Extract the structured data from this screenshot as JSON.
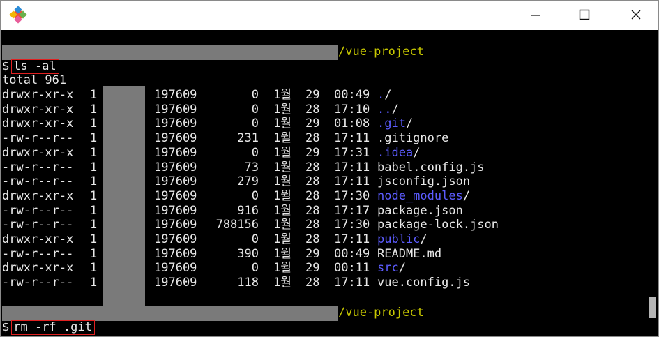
{
  "window": {
    "buttons": {
      "minimize": "minimize",
      "maximize": "maximize",
      "close": "close"
    }
  },
  "terminal": {
    "prompt1": {
      "path": "/vue-project",
      "symbol": "$",
      "command": "ls -al"
    },
    "total": "total 961",
    "listing": [
      {
        "perm": "drwxr-xr-x",
        "links": "1",
        "group": "197609",
        "size": "0",
        "month": "1월",
        "day": "29",
        "time": "00:49",
        "name": "./",
        "is_dir": true
      },
      {
        "perm": "drwxr-xr-x",
        "links": "1",
        "group": "197609",
        "size": "0",
        "month": "1월",
        "day": "28",
        "time": "17:10",
        "name": "../",
        "is_dir": true
      },
      {
        "perm": "drwxr-xr-x",
        "links": "1",
        "group": "197609",
        "size": "0",
        "month": "1월",
        "day": "29",
        "time": "01:08",
        "name": ".git",
        "is_dir": true
      },
      {
        "perm": "-rw-r--r--",
        "links": "1",
        "group": "197609",
        "size": "231",
        "month": "1월",
        "day": "28",
        "time": "17:11",
        "name": ".gitignore",
        "is_dir": false
      },
      {
        "perm": "drwxr-xr-x",
        "links": "1",
        "group": "197609",
        "size": "0",
        "month": "1월",
        "day": "29",
        "time": "17:31",
        "name": ".idea",
        "is_dir": true
      },
      {
        "perm": "-rw-r--r--",
        "links": "1",
        "group": "197609",
        "size": "73",
        "month": "1월",
        "day": "28",
        "time": "17:11",
        "name": "babel.config.js",
        "is_dir": false
      },
      {
        "perm": "-rw-r--r--",
        "links": "1",
        "group": "197609",
        "size": "279",
        "month": "1월",
        "day": "28",
        "time": "17:11",
        "name": "jsconfig.json",
        "is_dir": false
      },
      {
        "perm": "drwxr-xr-x",
        "links": "1",
        "group": "197609",
        "size": "0",
        "month": "1월",
        "day": "28",
        "time": "17:30",
        "name": "node_modules",
        "is_dir": true
      },
      {
        "perm": "-rw-r--r--",
        "links": "1",
        "group": "197609",
        "size": "916",
        "month": "1월",
        "day": "28",
        "time": "17:17",
        "name": "package.json",
        "is_dir": false
      },
      {
        "perm": "-rw-r--r--",
        "links": "1",
        "group": "197609",
        "size": "788156",
        "month": "1월",
        "day": "28",
        "time": "17:30",
        "name": "package-lock.json",
        "is_dir": false
      },
      {
        "perm": "drwxr-xr-x",
        "links": "1",
        "group": "197609",
        "size": "0",
        "month": "1월",
        "day": "28",
        "time": "17:11",
        "name": "public",
        "is_dir": true
      },
      {
        "perm": "-rw-r--r--",
        "links": "1",
        "group": "197609",
        "size": "390",
        "month": "1월",
        "day": "29",
        "time": "00:49",
        "name": "README.md",
        "is_dir": false
      },
      {
        "perm": "drwxr-xr-x",
        "links": "1",
        "group": "197609",
        "size": "0",
        "month": "1월",
        "day": "29",
        "time": "00:11",
        "name": "src",
        "is_dir": true
      },
      {
        "perm": "-rw-r--r--",
        "links": "1",
        "group": "197609",
        "size": "118",
        "month": "1월",
        "day": "28",
        "time": "17:11",
        "name": "vue.config.js",
        "is_dir": false
      }
    ],
    "prompt2": {
      "path": "/vue-project",
      "symbol": "$",
      "command": "rm -rf .git"
    }
  },
  "colors": {
    "background": "#000000",
    "text": "#e8e8e8",
    "path": "#c8c800",
    "directory": "#5c5cff",
    "highlight_box": "#e02020",
    "redaction": "#7a7a7a"
  }
}
